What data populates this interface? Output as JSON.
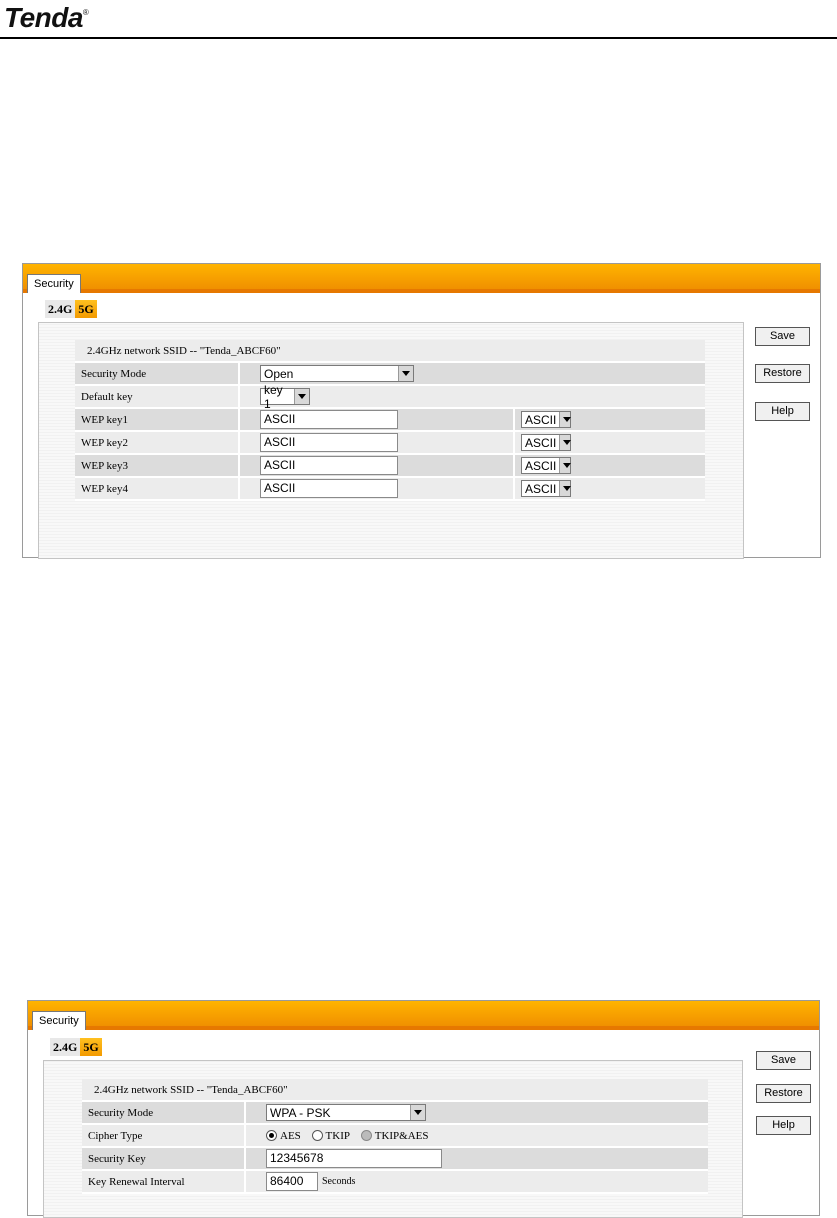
{
  "header": {
    "logo": "Tenda",
    "registered": "®"
  },
  "screen1": {
    "tab": "Security",
    "bands": [
      "2.4G",
      "5G"
    ],
    "ssid": "2.4GHz network SSID -- \"Tenda_ABCF60\"",
    "security_mode": {
      "label": "Security Mode",
      "value": "Open"
    },
    "default_key": {
      "label": "Default key",
      "value": "key 1"
    },
    "wep_keys": [
      {
        "label": "WEP key1",
        "value": "ASCII",
        "type": "ASCII"
      },
      {
        "label": "WEP key2",
        "value": "ASCII",
        "type": "ASCII"
      },
      {
        "label": "WEP key3",
        "value": "ASCII",
        "type": "ASCII"
      },
      {
        "label": "WEP key4",
        "value": "ASCII",
        "type": "ASCII"
      }
    ],
    "buttons": {
      "save": "Save",
      "restore": "Restore",
      "help": "Help"
    }
  },
  "screen2": {
    "tab": "Security",
    "bands": [
      "2.4G",
      "5G"
    ],
    "ssid": "2.4GHz network SSID -- \"Tenda_ABCF60\"",
    "security_mode": {
      "label": "Security Mode",
      "value": "WPA - PSK"
    },
    "cipher": {
      "label": "Cipher Type",
      "options": [
        "AES",
        "TKIP",
        "TKIP&AES"
      ],
      "selected": "AES"
    },
    "security_key": {
      "label": "Security Key",
      "value": "12345678"
    },
    "renewal": {
      "label": "Key Renewal Interval",
      "value": "86400",
      "unit": "Seconds"
    },
    "buttons": {
      "save": "Save",
      "restore": "Restore",
      "help": "Help"
    }
  }
}
